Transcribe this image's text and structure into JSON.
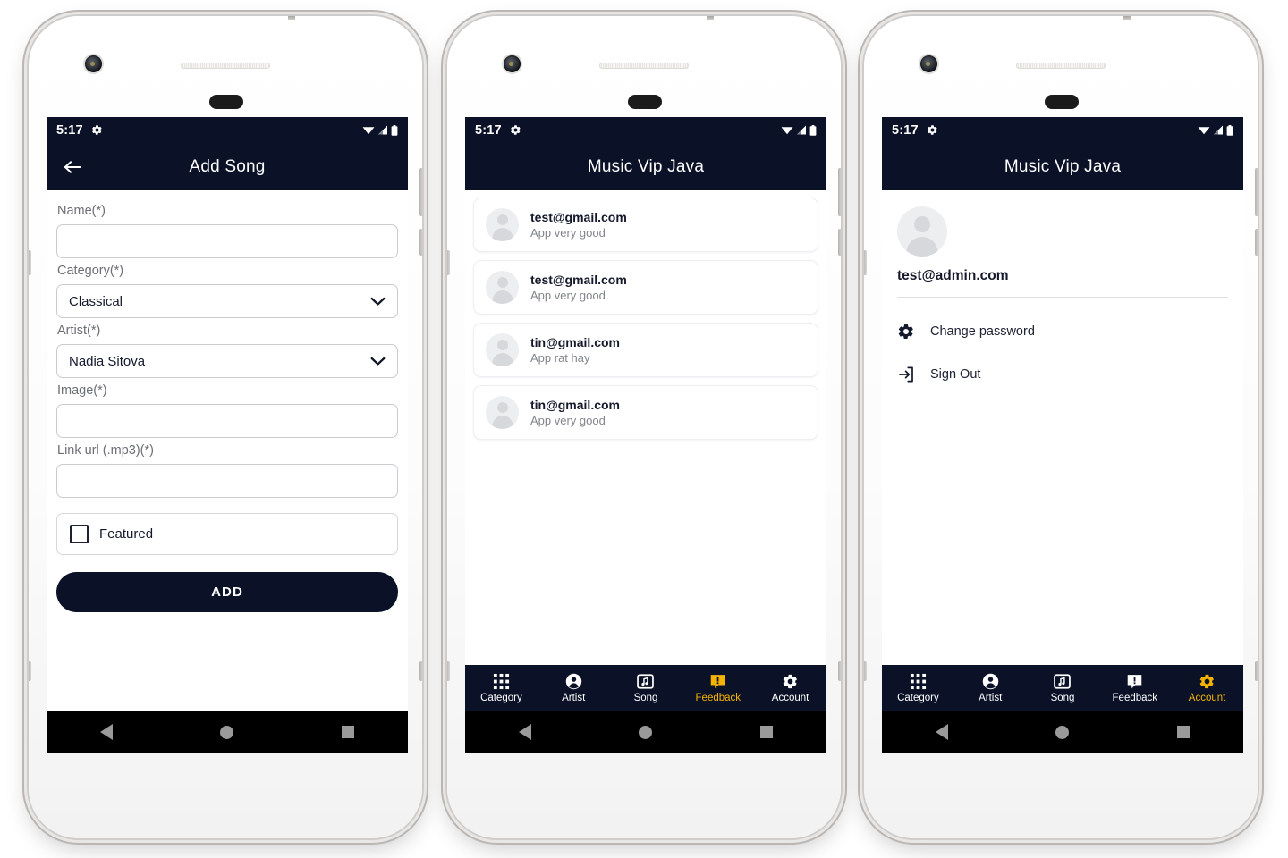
{
  "app": {
    "accent_color": "#f5b301",
    "appbar_color": "#0b1228",
    "screen_bg": "#ffffff"
  },
  "status_bar": {
    "time": "5:17",
    "gear_icon": "gear-icon",
    "wifi_icon": "wifi-icon",
    "signal_icon": "signal-icon",
    "battery_icon": "battery-icon"
  },
  "system_nav": {
    "back_icon": "triangle-back-icon",
    "home_icon": "circle-home-icon",
    "recents_icon": "square-recents-icon"
  },
  "bottom_nav": {
    "items": [
      {
        "label": "Category",
        "icon": "grid-icon",
        "active": false
      },
      {
        "label": "Artist",
        "icon": "person-icon",
        "active": false
      },
      {
        "label": "Song",
        "icon": "music-note-icon",
        "active": false
      },
      {
        "label": "Feedback",
        "icon": "feedback-icon",
        "active": false
      },
      {
        "label": "Account",
        "icon": "gear-icon",
        "active": false
      }
    ]
  },
  "screen1": {
    "appbar": {
      "title": "Add Song",
      "back_icon": "arrow-left-icon"
    },
    "fields": [
      {
        "label": "Name(*)",
        "type": "text",
        "value": ""
      },
      {
        "label": "Category(*)",
        "type": "select",
        "value": "Classical"
      },
      {
        "label": "Artist(*)",
        "type": "select",
        "value": "Nadia Sitova"
      },
      {
        "label": "Image(*)",
        "type": "text",
        "value": ""
      },
      {
        "label": "Link url (.mp3)(*)",
        "type": "text",
        "value": ""
      }
    ],
    "checkbox": {
      "label": "Featured",
      "checked": false
    },
    "submit_label": "ADD"
  },
  "screen2": {
    "appbar": {
      "title": "Music Vip Java"
    },
    "feedback_items": [
      {
        "email": "test@gmail.com",
        "message": "App very good"
      },
      {
        "email": "test@gmail.com",
        "message": "App very good"
      },
      {
        "email": "tin@gmail.com",
        "message": "App rat hay"
      },
      {
        "email": "tin@gmail.com",
        "message": "App very good"
      }
    ],
    "active_nav": "Feedback"
  },
  "screen3": {
    "appbar": {
      "title": "Music Vip Java"
    },
    "email": "test@admin.com",
    "menu": [
      {
        "label": "Change password",
        "icon": "gear-icon"
      },
      {
        "label": "Sign Out",
        "icon": "sign-out-icon"
      }
    ],
    "active_nav": "Account"
  }
}
